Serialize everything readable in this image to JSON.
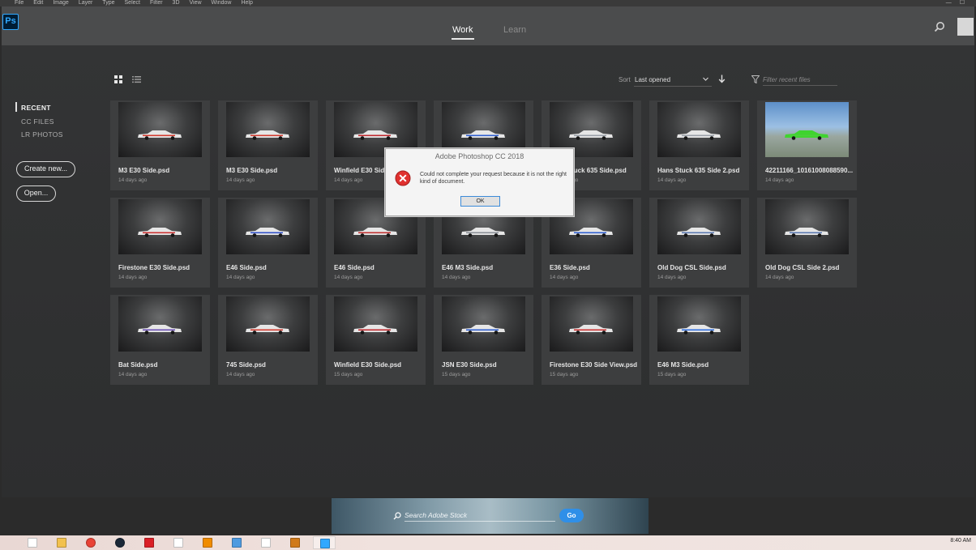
{
  "menu": [
    "File",
    "Edit",
    "Image",
    "Layer",
    "Type",
    "Select",
    "Filter",
    "3D",
    "View",
    "Window",
    "Help"
  ],
  "window_controls": [
    "—",
    "☐"
  ],
  "app": {
    "logo": "Ps"
  },
  "tabs": [
    {
      "label": "Work",
      "active": true
    },
    {
      "label": "Learn",
      "active": false
    }
  ],
  "sidebar": {
    "items": [
      "RECENT",
      "CC FILES",
      "LR PHOTOS"
    ],
    "create_label": "Create new...",
    "open_label": "Open..."
  },
  "toolbar": {
    "sort_label": "Sort",
    "sort_value": "Last opened",
    "filter_placeholder": "Filter recent files"
  },
  "files": [
    {
      "title": "M3 E30 Side.psd",
      "date": "14 days ago",
      "stripe": "#d23b2f"
    },
    {
      "title": "M3 E30 Side.psd",
      "date": "14 days ago",
      "stripe": "#d23b2f"
    },
    {
      "title": "Winfield E30 Side.psd",
      "date": "14 days ago",
      "stripe": "#c0282d"
    },
    {
      "title": "",
      "date": "",
      "stripe": "#2f5fd0"
    },
    {
      "title": "Hans Stuck 635 Side.psd",
      "date": "14 days ago",
      "stripe": "#9aa0a8"
    },
    {
      "title": "Hans Stuck 635 Side 2.psd",
      "date": "14 days ago",
      "stripe": "#9aa0a8"
    },
    {
      "title": "42211166_10161008088590...",
      "date": "14 days ago",
      "stripe": "#4bd13b",
      "landscape": true
    },
    {
      "title": "Firestone E30 Side.psd",
      "date": "14 days ago",
      "stripe": "#cc3333"
    },
    {
      "title": "E46 Side.psd",
      "date": "14 days ago",
      "stripe": "#3050c8"
    },
    {
      "title": "E46 Side.psd",
      "date": "14 days ago",
      "stripe": "#c03030"
    },
    {
      "title": "E46 M3 Side.psd",
      "date": "14 days ago",
      "stripe": "#8a8f96"
    },
    {
      "title": "E36 Side.psd",
      "date": "14 days ago",
      "stripe": "#2f5fd0"
    },
    {
      "title": "Old Dog CSL Side.psd",
      "date": "14 days ago",
      "stripe": "#5a78b0"
    },
    {
      "title": "Old Dog CSL Side 2.psd",
      "date": "14 days ago",
      "stripe": "#5a78b0"
    },
    {
      "title": "Bat Side.psd",
      "date": "14 days ago",
      "stripe": "#6b4fb5"
    },
    {
      "title": "745 Side.psd",
      "date": "14 days ago",
      "stripe": "#d23b2f"
    },
    {
      "title": "Winfield E30 Side.psd",
      "date": "15 days ago",
      "stripe": "#c0282d"
    },
    {
      "title": "JSN E30 Side.psd",
      "date": "15 days ago",
      "stripe": "#2f5fd0"
    },
    {
      "title": "Firestone E30 Side View.psd",
      "date": "15 days ago",
      "stripe": "#cc3333"
    },
    {
      "title": "E46 M3 Side.psd",
      "date": "15 days ago",
      "stripe": "#2f6fe0"
    }
  ],
  "dialog": {
    "title": "Adobe Photoshop CC 2018",
    "message": "Could not complete your request because it is not the right kind of document.",
    "ok_label": "OK"
  },
  "stock": {
    "placeholder": "Search Adobe Stock",
    "go_label": "Go"
  },
  "taskbar": {
    "apps": [
      "windows",
      "file-explorer",
      "chrome",
      "steam",
      "creative-cloud",
      "document",
      "vlc",
      "calculator",
      "document-2",
      "bridge",
      "photoshop"
    ],
    "active_app": "photoshop",
    "time": "8:40 AM"
  }
}
